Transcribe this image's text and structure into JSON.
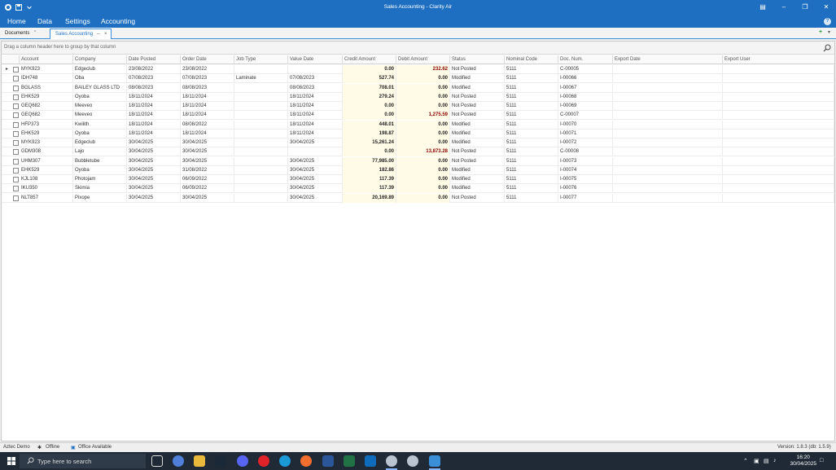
{
  "window": {
    "title": "Sales Accounting - Clarity Air"
  },
  "menu": {
    "items": [
      "Home",
      "Data",
      "Settings",
      "Accounting"
    ]
  },
  "tabs": [
    {
      "label": "Documents"
    },
    {
      "label": "Sales Accounting"
    }
  ],
  "grid": {
    "group_hint": "Drag a column header here to group by that column",
    "columns": [
      "Account",
      "Company",
      "Date Posted",
      "Order Date",
      "Job Type",
      "Value Date",
      "Credit Amount",
      "Debit Amount",
      "Status",
      "Nominal Code",
      "Doc. Num.",
      "Export Date",
      "Export User"
    ],
    "rows": [
      {
        "account": "MYK923",
        "company": "Edgeclub",
        "date_posted": "23/08/2022",
        "order_date": "23/08/2022",
        "job_type": "",
        "value_date": "",
        "credit": "0.00",
        "debit": "232.62",
        "status": "Not Posted",
        "nominal": "5111",
        "doc": "C-00005",
        "export_date": "",
        "export_user": ""
      },
      {
        "account": "IDH748",
        "company": "Oba",
        "date_posted": "07/08/2023",
        "order_date": "07/08/2023",
        "job_type": "Laminate",
        "value_date": "07/08/2023",
        "credit": "527.74",
        "debit": "0.00",
        "status": "Modified",
        "nominal": "5111",
        "doc": "I-00066",
        "export_date": "",
        "export_user": ""
      },
      {
        "account": "BGLASS",
        "company": "BAILEY GLASS LTD",
        "date_posted": "08/08/2023",
        "order_date": "08/08/2023",
        "job_type": "",
        "value_date": "08/08/2023",
        "credit": "708.01",
        "debit": "0.00",
        "status": "Modified",
        "nominal": "5111",
        "doc": "I-00067",
        "export_date": "",
        "export_user": ""
      },
      {
        "account": "EHK529",
        "company": "Oyoba",
        "date_posted": "18/11/2024",
        "order_date": "18/11/2024",
        "job_type": "",
        "value_date": "18/11/2024",
        "credit": "279.24",
        "debit": "0.00",
        "status": "Not Posted",
        "nominal": "5111",
        "doc": "I-00068",
        "export_date": "",
        "export_user": ""
      },
      {
        "account": "GEQ682",
        "company": "Meeveo",
        "date_posted": "18/11/2024",
        "order_date": "18/11/2024",
        "job_type": "",
        "value_date": "18/11/2024",
        "credit": "0.00",
        "debit": "0.00",
        "status": "Not Posted",
        "nominal": "5111",
        "doc": "I-00069",
        "export_date": "",
        "export_user": ""
      },
      {
        "account": "GEQ682",
        "company": "Meeveo",
        "date_posted": "18/11/2024",
        "order_date": "18/11/2024",
        "job_type": "",
        "value_date": "18/11/2024",
        "credit": "0.00",
        "debit": "1,275.59",
        "status": "Not Posted",
        "nominal": "5111",
        "doc": "C-00007",
        "export_date": "",
        "export_user": ""
      },
      {
        "account": "HFP373",
        "company": "Kwilith",
        "date_posted": "18/11/2024",
        "order_date": "08/08/2022",
        "job_type": "",
        "value_date": "18/11/2024",
        "credit": "448.01",
        "debit": "0.00",
        "status": "Modified",
        "nominal": "5111",
        "doc": "I-00070",
        "export_date": "",
        "export_user": ""
      },
      {
        "account": "EHK529",
        "company": "Oyoba",
        "date_posted": "18/11/2024",
        "order_date": "18/11/2024",
        "job_type": "",
        "value_date": "18/11/2024",
        "credit": "198.87",
        "debit": "0.00",
        "status": "Modified",
        "nominal": "5111",
        "doc": "I-00071",
        "export_date": "",
        "export_user": ""
      },
      {
        "account": "MYK923",
        "company": "Edgeclub",
        "date_posted": "30/04/2025",
        "order_date": "30/04/2025",
        "job_type": "",
        "value_date": "30/04/2025",
        "credit": "15,261.24",
        "debit": "0.00",
        "status": "Modified",
        "nominal": "5111",
        "doc": "I-00072",
        "export_date": "",
        "export_user": ""
      },
      {
        "account": "GDM308",
        "company": "Lajo",
        "date_posted": "30/04/2025",
        "order_date": "30/04/2025",
        "job_type": "",
        "value_date": "",
        "credit": "0.00",
        "debit": "13,873.28",
        "status": "Not Posted",
        "nominal": "5111",
        "doc": "C-00008",
        "export_date": "",
        "export_user": ""
      },
      {
        "account": "UHM307",
        "company": "Bubbletube",
        "date_posted": "30/04/2025",
        "order_date": "30/04/2025",
        "job_type": "",
        "value_date": "30/04/2025",
        "credit": "77,985.00",
        "debit": "0.00",
        "status": "Not Posted",
        "nominal": "5111",
        "doc": "I-00073",
        "export_date": "",
        "export_user": ""
      },
      {
        "account": "EHK529",
        "company": "Oyoba",
        "date_posted": "30/04/2025",
        "order_date": "31/08/2022",
        "job_type": "",
        "value_date": "30/04/2025",
        "credit": "182.86",
        "debit": "0.00",
        "status": "Modified",
        "nominal": "5111",
        "doc": "I-00074",
        "export_date": "",
        "export_user": ""
      },
      {
        "account": "KJL108",
        "company": "Photojam",
        "date_posted": "30/04/2025",
        "order_date": "06/09/2022",
        "job_type": "",
        "value_date": "30/04/2025",
        "credit": "117.39",
        "debit": "0.00",
        "status": "Modified",
        "nominal": "5111",
        "doc": "I-00075",
        "export_date": "",
        "export_user": ""
      },
      {
        "account": "IKU350",
        "company": "Skimia",
        "date_posted": "30/04/2025",
        "order_date": "06/09/2022",
        "job_type": "",
        "value_date": "30/04/2025",
        "credit": "117.39",
        "debit": "0.00",
        "status": "Modified",
        "nominal": "5111",
        "doc": "I-00076",
        "export_date": "",
        "export_user": ""
      },
      {
        "account": "NLT857",
        "company": "Pixope",
        "date_posted": "30/04/2025",
        "order_date": "30/04/2025",
        "job_type": "",
        "value_date": "30/04/2025",
        "credit": "20,169.89",
        "debit": "0.00",
        "status": "Not Posted",
        "nominal": "5111",
        "doc": "I-00077",
        "export_date": "",
        "export_user": ""
      }
    ]
  },
  "statusbar": {
    "company": "Aztec Demo",
    "offline": "Offline",
    "office": "Office Available",
    "version": "Version: 1.8.3 (db: 1.5.9)"
  },
  "taskbar": {
    "search_placeholder": "Type here to search",
    "time": "16:20",
    "date": "30/04/2025"
  },
  "colors": {
    "accent": "#1e6fc1",
    "debit_text": "#8b0000",
    "amount_bg": "#fffbe6"
  }
}
